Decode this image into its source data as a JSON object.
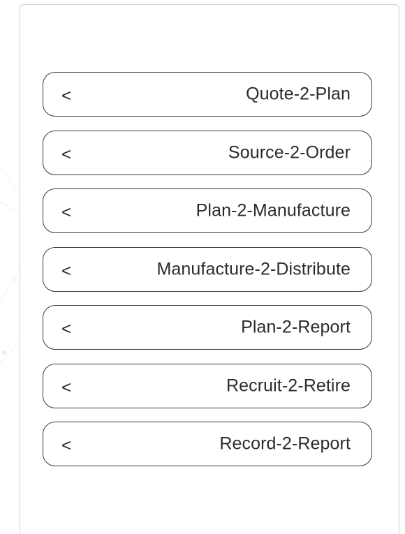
{
  "menu": {
    "items": [
      {
        "label": "Quote-2-Plan",
        "icon": "<"
      },
      {
        "label": "Source-2-Order",
        "icon": "<"
      },
      {
        "label": "Plan-2-Manufacture",
        "icon": "<"
      },
      {
        "label": "Manufacture-2-Distribute",
        "icon": "<"
      },
      {
        "label": "Plan-2-Report",
        "icon": "<"
      },
      {
        "label": "Recruit-2-Retire",
        "icon": "<"
      },
      {
        "label": "Record-2-Report",
        "icon": "<"
      }
    ]
  },
  "colors": {
    "border": "#3a3a3a",
    "panel_border": "#cfcfcf",
    "text": "#2b2b2b",
    "background": "#ffffff"
  }
}
